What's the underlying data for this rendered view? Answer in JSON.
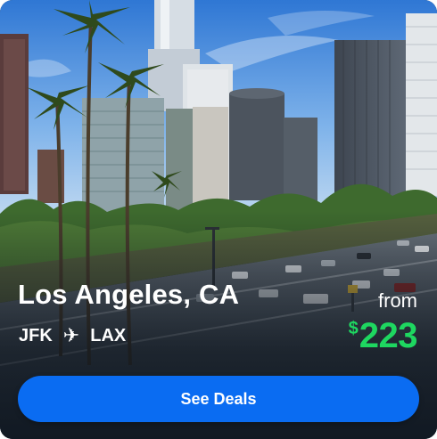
{
  "destination": {
    "city": "Los Angeles, CA",
    "origin": "JFK",
    "arrival": "LAX",
    "route_icon": "airplane-icon"
  },
  "pricing": {
    "prefix": "from",
    "currency": "$",
    "amount": "223"
  },
  "cta": {
    "label": "See Deals"
  },
  "colors": {
    "price": "#1ed760",
    "button": "#0a6cf2"
  }
}
